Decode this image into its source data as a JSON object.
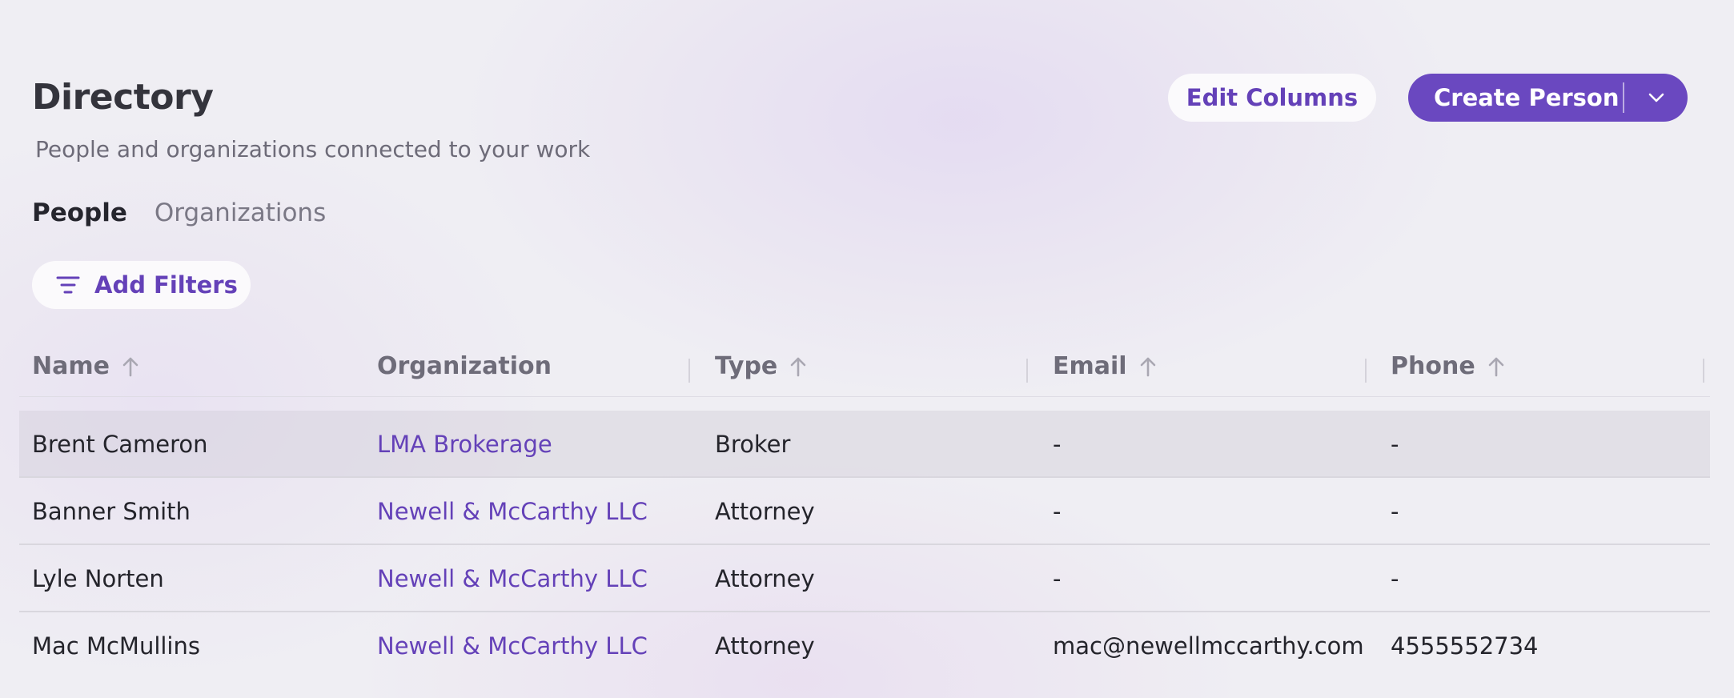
{
  "header": {
    "title": "Directory",
    "subtitle": "People and organizations connected to your work",
    "edit_columns_label": "Edit Columns",
    "create_person_label": "Create Person"
  },
  "tabs": [
    {
      "label": "People",
      "active": true
    },
    {
      "label": "Organizations",
      "active": false
    }
  ],
  "filters": {
    "add_filters_label": "Add Filters",
    "icon": "filter-icon"
  },
  "table": {
    "columns": [
      {
        "label": "Name",
        "sortable": true
      },
      {
        "label": "Organization",
        "sortable": false
      },
      {
        "label": "Type",
        "sortable": true
      },
      {
        "label": "Email",
        "sortable": true
      },
      {
        "label": "Phone",
        "sortable": true
      }
    ],
    "rows": [
      {
        "name": "Brent Cameron",
        "organization": "LMA Brokerage",
        "type": "Broker",
        "email": "-",
        "phone": "-"
      },
      {
        "name": "Banner Smith",
        "organization": "Newell & McCarthy LLC",
        "type": "Attorney",
        "email": "-",
        "phone": "-"
      },
      {
        "name": "Lyle Norten",
        "organization": "Newell & McCarthy LLC",
        "type": "Attorney",
        "email": "-",
        "phone": "-"
      },
      {
        "name": "Mac McMullins",
        "organization": "Newell & McCarthy LLC",
        "type": "Attorney",
        "email": "mac@newellmccarthy.com",
        "phone": "4555552734"
      }
    ]
  },
  "colors": {
    "accent": "#6a48c0",
    "link": "#6441b8",
    "background": "#efeef3"
  }
}
